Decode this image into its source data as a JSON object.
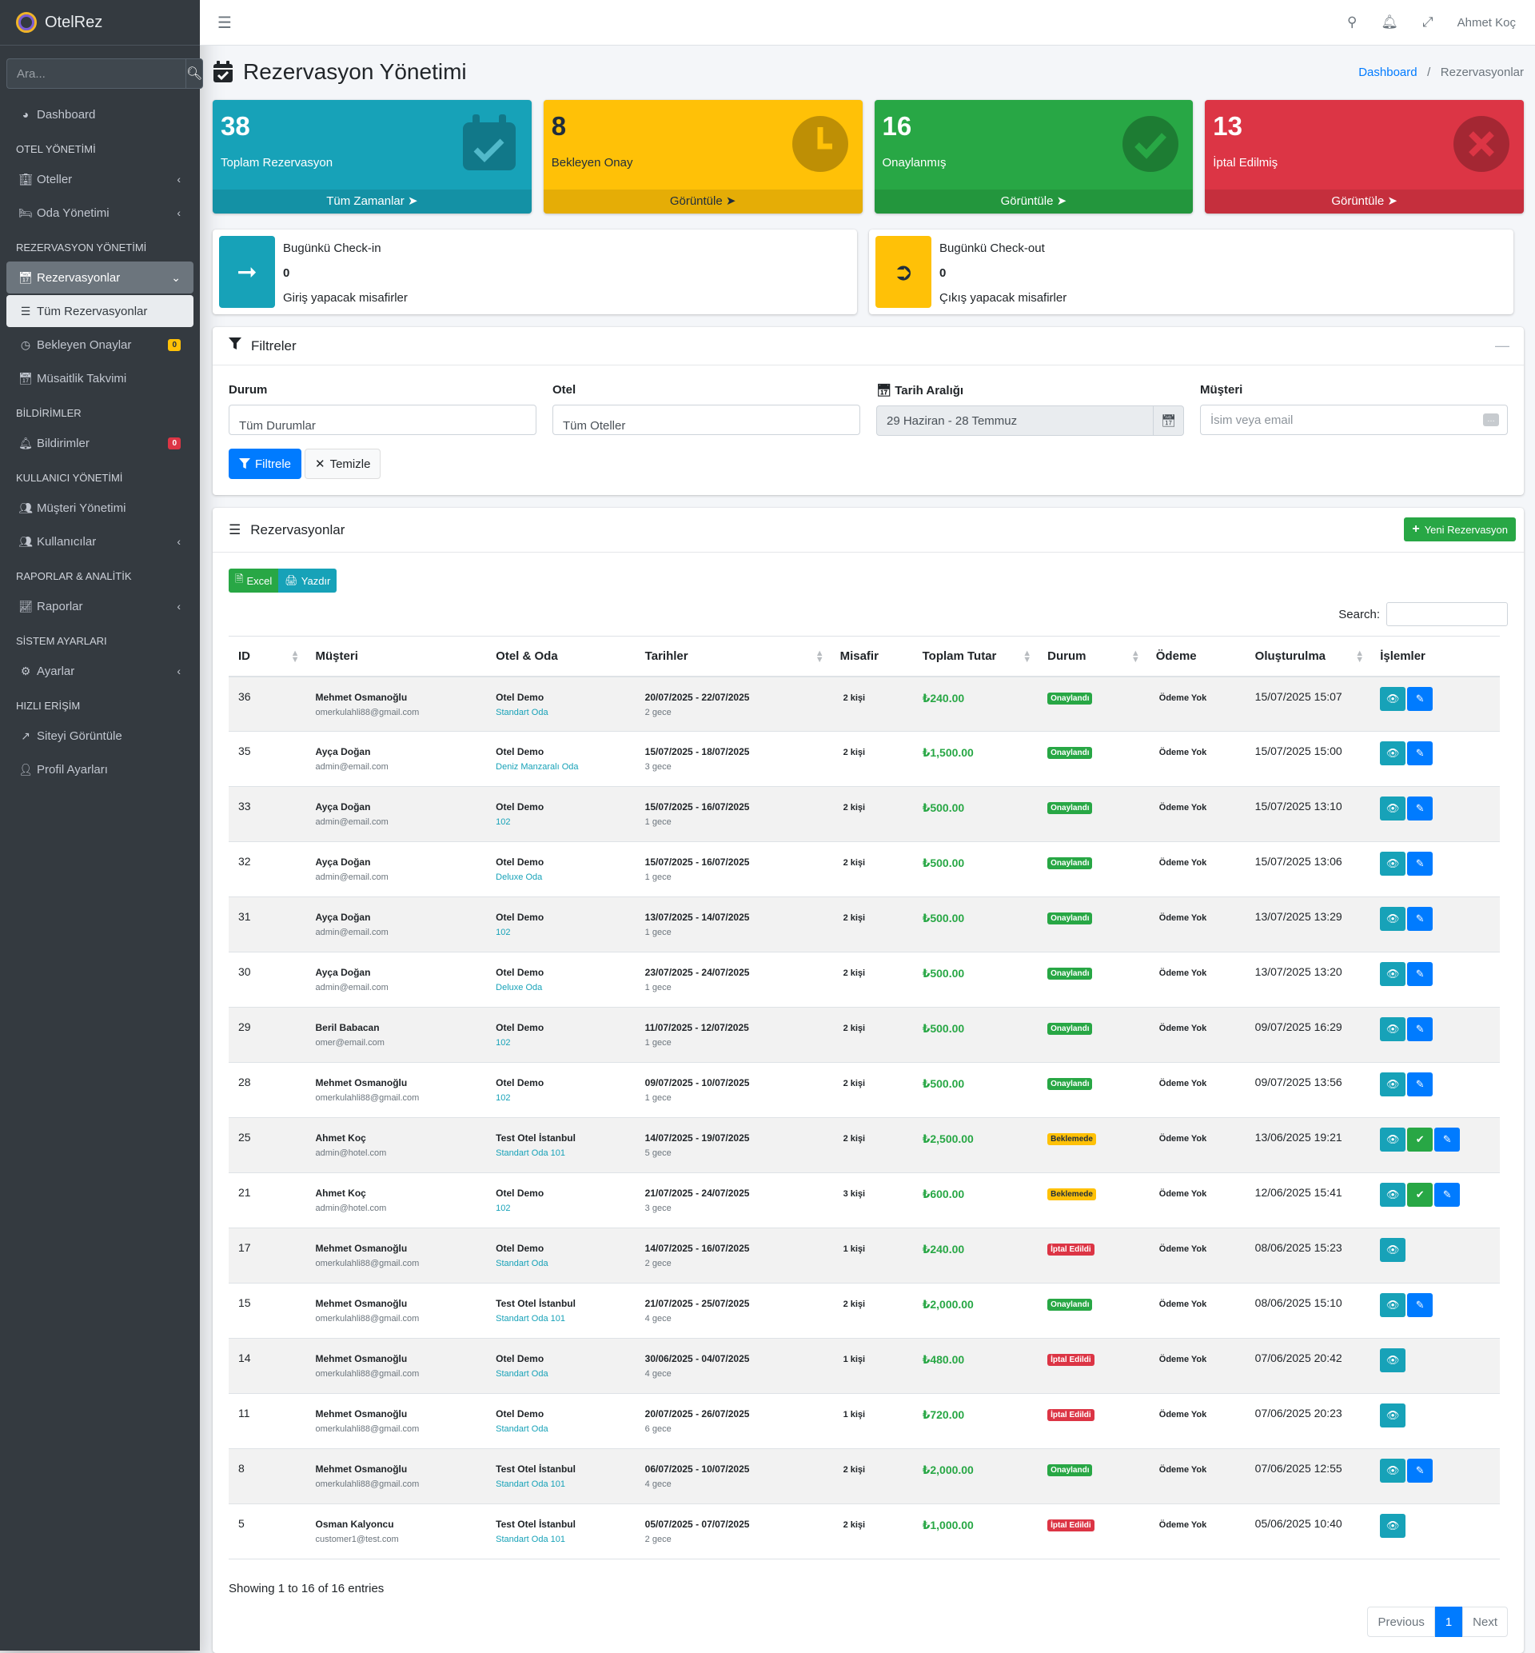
{
  "app": {
    "name": "OtelRez"
  },
  "sidebar": {
    "search_placeholder": "Ara...",
    "items": [
      {
        "type": "item",
        "label": "Dashboard",
        "icon": "tachometer-icon"
      },
      {
        "type": "header",
        "label": "OTEL YÖNETİMİ"
      },
      {
        "type": "item",
        "label": "Oteller",
        "icon": "building-icon",
        "chev": true
      },
      {
        "type": "item",
        "label": "Oda Yönetimi",
        "icon": "bed-icon",
        "chev": true
      },
      {
        "type": "header",
        "label": "REZERVASYON YÖNETİMİ"
      },
      {
        "type": "item",
        "label": "Rezervasyonlar",
        "icon": "calendar-check-icon",
        "chev": "down",
        "state": "active"
      },
      {
        "type": "item",
        "label": "Tüm Rezervasyonlar",
        "icon": "list-icon",
        "state": "sub-active"
      },
      {
        "type": "item",
        "label": "Bekleyen Onaylar",
        "icon": "clock-icon",
        "badge": "0",
        "badgeType": "warn"
      },
      {
        "type": "item",
        "label": "Müsaitlik Takvimi",
        "icon": "calendar-icon"
      },
      {
        "type": "header",
        "label": "BİLDİRİMLER"
      },
      {
        "type": "item",
        "label": "Bildirimler",
        "icon": "bell-icon",
        "badge": "0",
        "badgeType": "dang"
      },
      {
        "type": "header",
        "label": "KULLANICI YÖNETİMİ"
      },
      {
        "type": "item",
        "label": "Müşteri Yönetimi",
        "icon": "users-icon"
      },
      {
        "type": "item",
        "label": "Kullanıcılar",
        "icon": "users-cog-icon",
        "chev": true
      },
      {
        "type": "header",
        "label": "RAPORLAR & ANALİTİK"
      },
      {
        "type": "item",
        "label": "Raporlar",
        "icon": "chart-line-icon",
        "chev": true
      },
      {
        "type": "header",
        "label": "SİSTEM AYARLARI"
      },
      {
        "type": "item",
        "label": "Ayarlar",
        "icon": "cog-icon",
        "chev": true
      },
      {
        "type": "header",
        "label": "HIZLI ERİŞİM"
      },
      {
        "type": "item",
        "label": "Siteyi Görüntüle",
        "icon": "external-link-icon"
      },
      {
        "type": "item",
        "label": "Profil Ayarları",
        "icon": "user-cog-icon"
      }
    ]
  },
  "topbar": {
    "user": "Ahmet Koç"
  },
  "page": {
    "title": "Rezervasyon Yönetimi",
    "breadcrumb_home": "Dashboard",
    "breadcrumb_current": "Rezervasyonlar"
  },
  "stats": [
    {
      "value": "38",
      "label": "Toplam Rezervasyon",
      "footer": "Tüm Zamanlar",
      "color": "info",
      "icon": "calendar-check-icon"
    },
    {
      "value": "8",
      "label": "Bekleyen Onay",
      "footer": "Görüntüle",
      "color": "warn",
      "icon": "clock-icon"
    },
    {
      "value": "16",
      "label": "Onaylanmış",
      "footer": "Görüntüle",
      "color": "succ",
      "icon": "check-circle-icon"
    },
    {
      "value": "13",
      "label": "İptal Edilmiş",
      "footer": "Görüntüle",
      "color": "dang",
      "icon": "times-circle-icon"
    }
  ],
  "checkin": {
    "title": "Bugünkü Check-in",
    "count": "0",
    "desc": "Giriş yapacak misafirler"
  },
  "checkout": {
    "title": "Bugünkü Check-out",
    "count": "0",
    "desc": "Çıkış yapacak misafirler"
  },
  "filters": {
    "title": "Filtreler",
    "status_label": "Durum",
    "status_value": "Tüm Durumlar",
    "hotel_label": "Otel",
    "hotel_value": "Tüm Oteller",
    "date_label": "Tarih Aralığı",
    "date_value": "29 Haziran - 28 Temmuz",
    "customer_label": "Müşteri",
    "customer_placeholder": "İsim veya email",
    "apply": "Filtrele",
    "clear": "Temizle"
  },
  "reservations": {
    "title": "Rezervasyonlar",
    "new_button": "Yeni Rezervasyon",
    "excel": "Excel",
    "print": "Yazdır",
    "search_label": "Search:",
    "columns": [
      "ID",
      "Müşteri",
      "Otel & Oda",
      "Tarihler",
      "Misafir",
      "Toplam Tutar",
      "Durum",
      "Ödeme",
      "Oluşturulma",
      "İşlemler"
    ],
    "rows": [
      {
        "id": "36",
        "name": "Mehmet Osmanoğlu",
        "email": "omerkulahli88@gmail.com",
        "hotel": "Otel Demo",
        "room": "Standart Oda",
        "dates": "20/07/2025 - 22/07/2025",
        "nights": "2 gece",
        "guests": "2 kişi",
        "total": "₺240.00",
        "status": "Onaylandı",
        "st": "ok",
        "payment": "Ödeme Yok",
        "created": "15/07/2025 15:07",
        "acts": [
          "view",
          "edit"
        ]
      },
      {
        "id": "35",
        "name": "Ayça Doğan",
        "email": "admin@email.com",
        "hotel": "Otel Demo",
        "room": "Deniz Manzaralı Oda",
        "dates": "15/07/2025 - 18/07/2025",
        "nights": "3 gece",
        "guests": "2 kişi",
        "total": "₺1,500.00",
        "status": "Onaylandı",
        "st": "ok",
        "payment": "Ödeme Yok",
        "created": "15/07/2025 15:00",
        "acts": [
          "view",
          "edit"
        ]
      },
      {
        "id": "33",
        "name": "Ayça Doğan",
        "email": "admin@email.com",
        "hotel": "Otel Demo",
        "room": "102",
        "dates": "15/07/2025 - 16/07/2025",
        "nights": "1 gece",
        "guests": "2 kişi",
        "total": "₺500.00",
        "status": "Onaylandı",
        "st": "ok",
        "payment": "Ödeme Yok",
        "created": "15/07/2025 13:10",
        "acts": [
          "view",
          "edit"
        ]
      },
      {
        "id": "32",
        "name": "Ayça Doğan",
        "email": "admin@email.com",
        "hotel": "Otel Demo",
        "room": "Deluxe Oda",
        "dates": "15/07/2025 - 16/07/2025",
        "nights": "1 gece",
        "guests": "2 kişi",
        "total": "₺500.00",
        "status": "Onaylandı",
        "st": "ok",
        "payment": "Ödeme Yok",
        "created": "15/07/2025 13:06",
        "acts": [
          "view",
          "edit"
        ]
      },
      {
        "id": "31",
        "name": "Ayça Doğan",
        "email": "admin@email.com",
        "hotel": "Otel Demo",
        "room": "102",
        "dates": "13/07/2025 - 14/07/2025",
        "nights": "1 gece",
        "guests": "2 kişi",
        "total": "₺500.00",
        "status": "Onaylandı",
        "st": "ok",
        "payment": "Ödeme Yok",
        "created": "13/07/2025 13:29",
        "acts": [
          "view",
          "edit"
        ]
      },
      {
        "id": "30",
        "name": "Ayça Doğan",
        "email": "admin@email.com",
        "hotel": "Otel Demo",
        "room": "Deluxe Oda",
        "dates": "23/07/2025 - 24/07/2025",
        "nights": "1 gece",
        "guests": "2 kişi",
        "total": "₺500.00",
        "status": "Onaylandı",
        "st": "ok",
        "payment": "Ödeme Yok",
        "created": "13/07/2025 13:20",
        "acts": [
          "view",
          "edit"
        ]
      },
      {
        "id": "29",
        "name": "Beril Babacan",
        "email": "omer@email.com",
        "hotel": "Otel Demo",
        "room": "102",
        "dates": "11/07/2025 - 12/07/2025",
        "nights": "1 gece",
        "guests": "2 kişi",
        "total": "₺500.00",
        "status": "Onaylandı",
        "st": "ok",
        "payment": "Ödeme Yok",
        "created": "09/07/2025 16:29",
        "acts": [
          "view",
          "edit"
        ]
      },
      {
        "id": "28",
        "name": "Mehmet Osmanoğlu",
        "email": "omerkulahli88@gmail.com",
        "hotel": "Otel Demo",
        "room": "102",
        "dates": "09/07/2025 - 10/07/2025",
        "nights": "1 gece",
        "guests": "2 kişi",
        "total": "₺500.00",
        "status": "Onaylandı",
        "st": "ok",
        "payment": "Ödeme Yok",
        "created": "09/07/2025 13:56",
        "acts": [
          "view",
          "edit"
        ]
      },
      {
        "id": "25",
        "name": "Ahmet Koç",
        "email": "admin@hotel.com",
        "hotel": "Test Otel İstanbul",
        "room": "Standart Oda 101",
        "dates": "14/07/2025 - 19/07/2025",
        "nights": "5 gece",
        "guests": "2 kişi",
        "total": "₺2,500.00",
        "status": "Beklemede",
        "st": "wait",
        "payment": "Ödeme Yok",
        "created": "13/06/2025 19:21",
        "acts": [
          "view",
          "ok",
          "edit"
        ]
      },
      {
        "id": "21",
        "name": "Ahmet Koç",
        "email": "admin@hotel.com",
        "hotel": "Otel Demo",
        "room": "102",
        "dates": "21/07/2025 - 24/07/2025",
        "nights": "3 gece",
        "guests": "3 kişi",
        "total": "₺600.00",
        "status": "Beklemede",
        "st": "wait",
        "payment": "Ödeme Yok",
        "created": "12/06/2025 15:41",
        "acts": [
          "view",
          "ok",
          "edit"
        ]
      },
      {
        "id": "17",
        "name": "Mehmet Osmanoğlu",
        "email": "omerkulahli88@gmail.com",
        "hotel": "Otel Demo",
        "room": "Standart Oda",
        "dates": "14/07/2025 - 16/07/2025",
        "nights": "2 gece",
        "guests": "1 kişi",
        "total": "₺240.00",
        "status": "İptal Edildi",
        "st": "cancel",
        "payment": "Ödeme Yok",
        "created": "08/06/2025 15:23",
        "acts": [
          "view"
        ]
      },
      {
        "id": "15",
        "name": "Mehmet Osmanoğlu",
        "email": "omerkulahli88@gmail.com",
        "hotel": "Test Otel İstanbul",
        "room": "Standart Oda 101",
        "dates": "21/07/2025 - 25/07/2025",
        "nights": "4 gece",
        "guests": "2 kişi",
        "total": "₺2,000.00",
        "status": "Onaylandı",
        "st": "ok",
        "payment": "Ödeme Yok",
        "created": "08/06/2025 15:10",
        "acts": [
          "view",
          "edit"
        ]
      },
      {
        "id": "14",
        "name": "Mehmet Osmanoğlu",
        "email": "omerkulahli88@gmail.com",
        "hotel": "Otel Demo",
        "room": "Standart Oda",
        "dates": "30/06/2025 - 04/07/2025",
        "nights": "4 gece",
        "guests": "1 kişi",
        "total": "₺480.00",
        "status": "İptal Edildi",
        "st": "cancel",
        "payment": "Ödeme Yok",
        "created": "07/06/2025 20:42",
        "acts": [
          "view"
        ]
      },
      {
        "id": "11",
        "name": "Mehmet Osmanoğlu",
        "email": "omerkulahli88@gmail.com",
        "hotel": "Otel Demo",
        "room": "Standart Oda",
        "dates": "20/07/2025 - 26/07/2025",
        "nights": "6 gece",
        "guests": "1 kişi",
        "total": "₺720.00",
        "status": "İptal Edildi",
        "st": "cancel",
        "payment": "Ödeme Yok",
        "created": "07/06/2025 20:23",
        "acts": [
          "view"
        ]
      },
      {
        "id": "8",
        "name": "Mehmet Osmanoğlu",
        "email": "omerkulahli88@gmail.com",
        "hotel": "Test Otel İstanbul",
        "room": "Standart Oda 101",
        "dates": "06/07/2025 - 10/07/2025",
        "nights": "4 gece",
        "guests": "2 kişi",
        "total": "₺2,000.00",
        "status": "Onaylandı",
        "st": "ok",
        "payment": "Ödeme Yok",
        "created": "07/06/2025 12:55",
        "acts": [
          "view",
          "edit"
        ]
      },
      {
        "id": "5",
        "name": "Osman Kalyoncu",
        "email": "customer1@test.com",
        "hotel": "Test Otel İstanbul",
        "room": "Standart Oda 101",
        "dates": "05/07/2025 - 07/07/2025",
        "nights": "2 gece",
        "guests": "2 kişi",
        "total": "₺1,000.00",
        "status": "İptal Edildi",
        "st": "cancel",
        "payment": "Ödeme Yok",
        "created": "05/06/2025 10:40",
        "acts": [
          "view"
        ]
      }
    ],
    "info": "Showing 1 to 16 of 16 entries",
    "pager": {
      "prev": "Previous",
      "page": "1",
      "next": "Next"
    }
  }
}
